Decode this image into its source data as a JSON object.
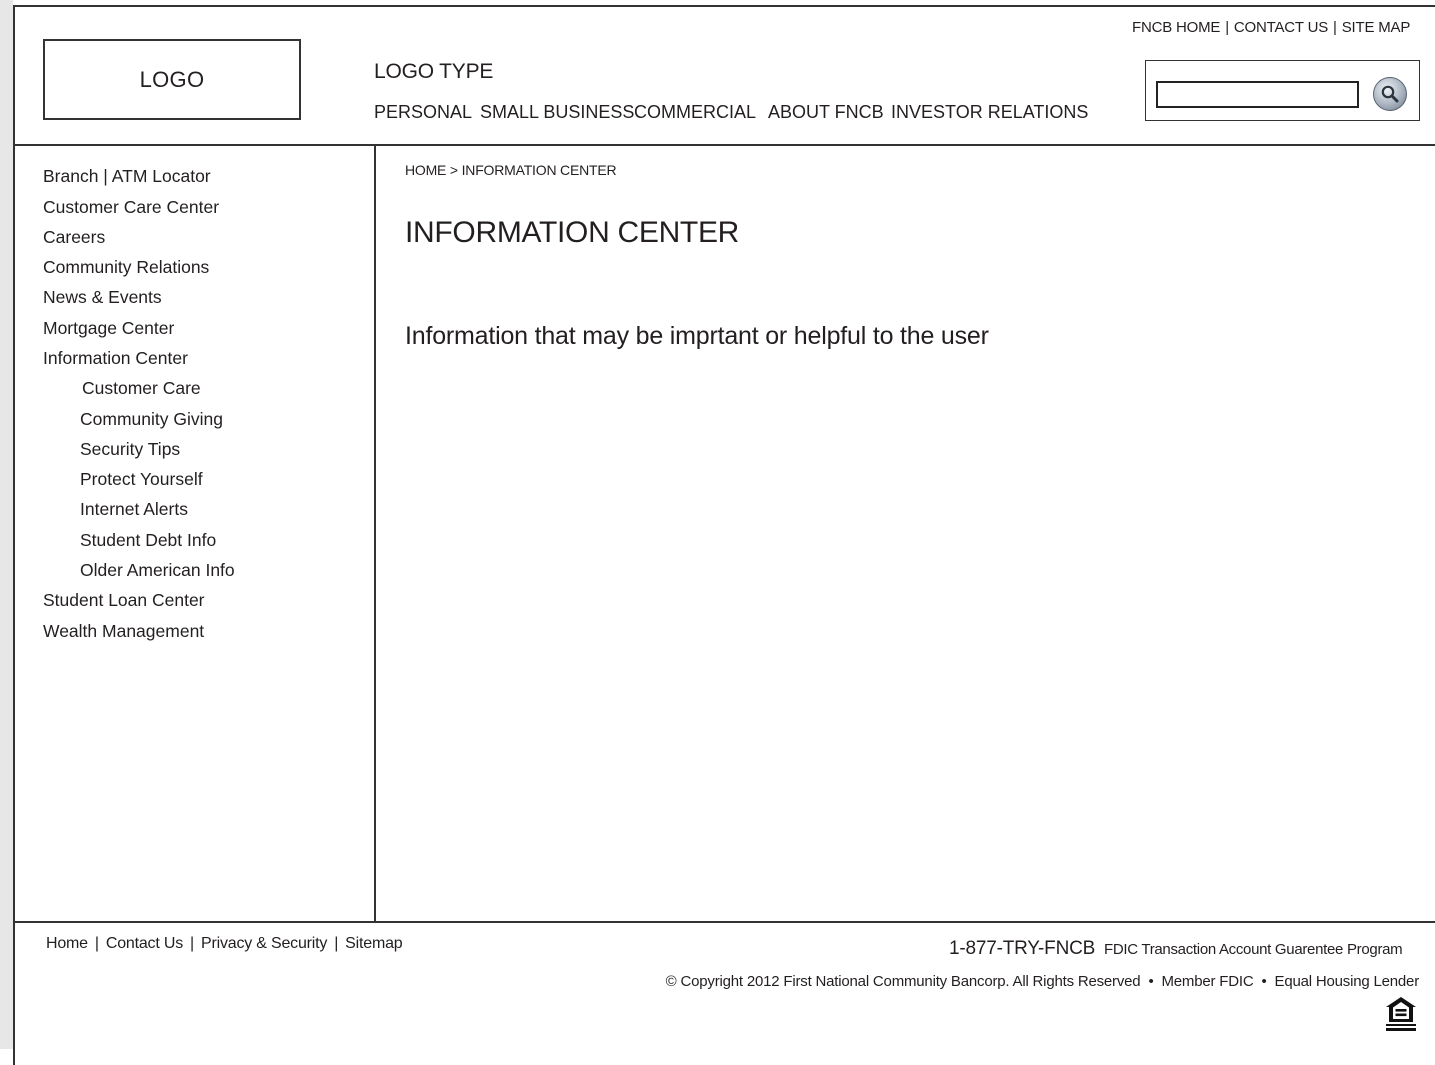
{
  "header": {
    "logo_text": "LOGO",
    "logo_type": "LOGO TYPE",
    "main_nav": [
      "PERSONAL",
      "SMALL BUSINESS",
      "COMMERCIAL",
      "ABOUT FNCB",
      "INVESTOR RELATIONS"
    ],
    "util_nav": {
      "home": "FNCB HOME",
      "contact": "CONTACT US",
      "sitemap": "SITE MAP",
      "separator": "|"
    },
    "search": {
      "value": "",
      "icon": "search-icon"
    }
  },
  "sidebar": {
    "items": [
      {
        "label": "Branch | ATM Locator"
      },
      {
        "label": "Customer Care Center"
      },
      {
        "label": "Careers"
      },
      {
        "label": "Community Relations"
      },
      {
        "label": "News & Events"
      },
      {
        "label": "Mortgage Center"
      },
      {
        "label": "Information Center"
      },
      {
        "label": "Customer Care"
      },
      {
        "label": "Community Giving"
      },
      {
        "label": "Security Tips"
      },
      {
        "label": "Protect Yourself"
      },
      {
        "label": "Internet Alerts"
      },
      {
        "label": "Student Debt Info"
      },
      {
        "label": "Older American Info"
      },
      {
        "label": "Student Loan Center"
      },
      {
        "label": "Wealth Management"
      }
    ]
  },
  "main": {
    "breadcrumb": {
      "home": "HOME",
      "separator": ">",
      "current": "INFORMATION CENTER"
    },
    "title": "INFORMATION CENTER",
    "intro": "Information that may be imprtant or helpful to the user"
  },
  "footer": {
    "links": [
      "Home",
      "Contact Us",
      "Privacy & Security",
      "Sitemap"
    ],
    "separator": "|",
    "phone": "1-877-TRY-FNCB",
    "fdic_program": "FDIC Transaction Account Guarentee Program",
    "copyright": "© Copyright 2012 First National Community Bancorp. All Rights Reserved",
    "bullet": "•",
    "member_fdic": "Member FDIC",
    "equal_housing": "Equal Housing Lender",
    "ehl_icon": "equal-housing-lender-icon"
  }
}
